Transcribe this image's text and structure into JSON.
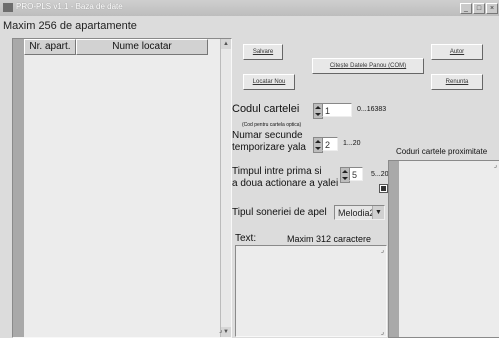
{
  "window": {
    "title": "PRO-PLS v1.1 - Baza de date",
    "controls": [
      "_",
      "□",
      "×"
    ]
  },
  "header": {
    "max_label": "Maxim 256 de apartamente"
  },
  "table": {
    "columns": [
      "Nr. apart.",
      "Nume locatar"
    ],
    "rows": []
  },
  "buttons": {
    "salvare": "Salvare",
    "locatar_nou": "Locatar Nou",
    "citeste": "Citește Datele Panou (COM)",
    "autor": "Autor",
    "renunta": "Renunta"
  },
  "form": {
    "cod_label": "Codul cartelei",
    "cod_value": "1",
    "cod_range": "0...16383",
    "cod_note": "(Cod pentru cartela optica)",
    "secunde_label_1": "Numar secunde",
    "secunde_label_2": "temporizare yala",
    "secunde_value": "2",
    "secunde_range": "1...20",
    "timp_label_1": "Timpul intre prima si",
    "timp_label_2": "a doua actionare a yalei",
    "timp_value": "5",
    "timp_range": "5...20",
    "timp_checked": true,
    "sonerie_label": "Tipul soneriei de apel",
    "sonerie_value": "Melodia2",
    "text_label": "Text:",
    "text_hint": "Maxim 312 caractere",
    "text_value": ""
  },
  "proximity": {
    "label": "Coduri cartele proximitate",
    "items": []
  }
}
